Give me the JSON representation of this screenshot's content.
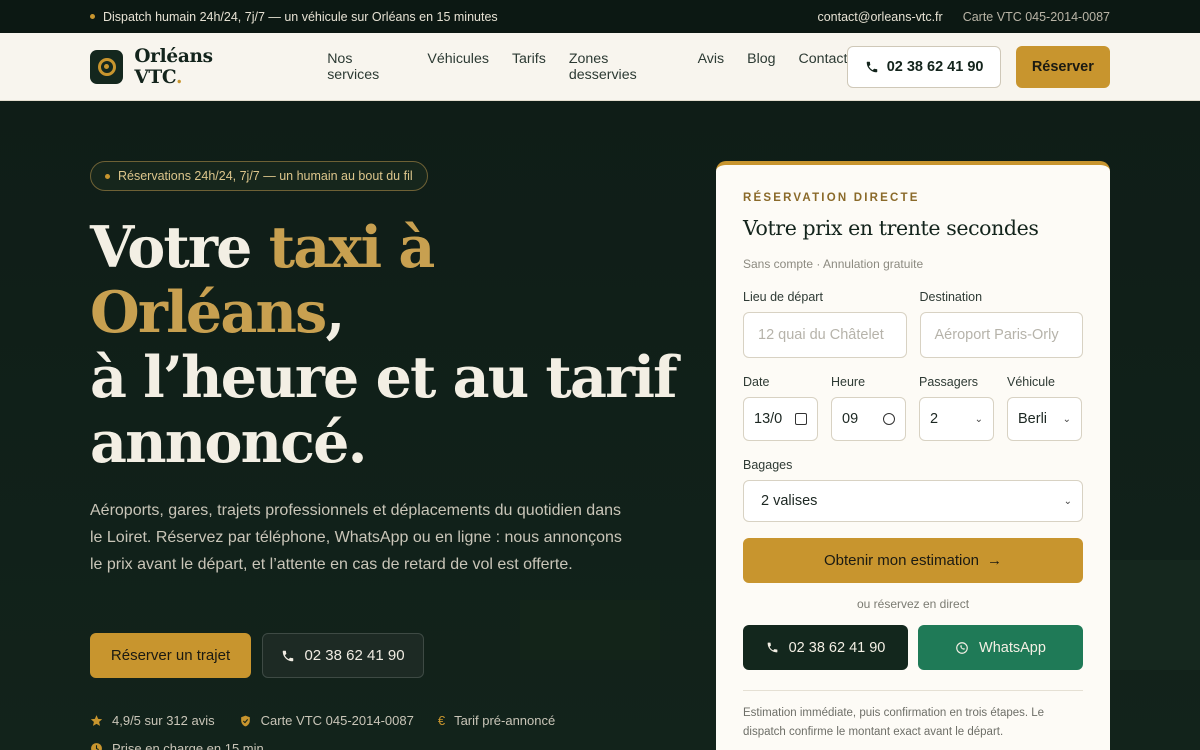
{
  "topbar": {
    "dispatch": "Dispatch humain 24h/24, 7j/7 — un véhicule sur Orléans en 15 minutes",
    "email": "contact@orleans-vtc.fr",
    "license": "Carte VTC 045-2014-0087"
  },
  "header": {
    "brand": "Orléans VTC",
    "brand_dot": ".",
    "nav": [
      "Nos services",
      "Véhicules",
      "Tarifs",
      "Zones desservies",
      "Avis",
      "Blog",
      "Contact"
    ],
    "phone": "02 38 62 41 90",
    "reserve": "Réserver"
  },
  "hero": {
    "badge": "Réservations 24h/24, 7j/7 — un humain au bout du fil",
    "h_line1_a": "Votre ",
    "h_line1_b": "taxi à",
    "h_line2_a": "Orléans",
    "h_line2_b": ",",
    "h_line3": "à l’heure et au tarif",
    "h_line4": "annoncé.",
    "lead": "Aéroports, gares, trajets professionnels et déplacements du quotidien dans le Loiret. Réservez par téléphone, WhatsApp ou en ligne : nous annonçons le prix avant le départ, et l’attente en cas de retard de vol est offerte.",
    "cta_primary": "Réserver un trajet",
    "cta_phone": "02 38 62 41 90",
    "trust": [
      {
        "icon": "star-icon",
        "text": "4,9/5 sur 312 avis"
      },
      {
        "icon": "shield-icon",
        "text": "Carte VTC 045-2014-0087"
      },
      {
        "icon": "euro-icon",
        "text": "Tarif pré-annoncé"
      }
    ],
    "trust2": "Prise en charge en 15 min"
  },
  "booking": {
    "eyebrow": "RÉSERVATION DIRECTE",
    "title": "Votre prix en trente secondes",
    "subtitle": "Sans compte · Annulation gratuite",
    "departure_label": "Lieu de départ",
    "departure_placeholder": "12 quai du Châtelet",
    "destination_label": "Destination",
    "destination_placeholder": "Aéroport Paris-Orly",
    "date_label": "Date",
    "date_value": "13/0",
    "time_label": "Heure",
    "time_value": "09",
    "passengers_label": "Passagers",
    "passengers_value": "2",
    "vehicle_label": "Véhicule",
    "vehicle_value": "Berli",
    "luggage_label": "Bagages",
    "luggage_value": "2 valises",
    "estimate_button": "Obtenir mon estimation",
    "or_text": "ou réservez en direct",
    "call_button": "02 38 62 41 90",
    "whatsapp_button": "WhatsApp",
    "footer_note": "Estimation immédiate, puis confirmation en trois étapes. Le dispatch confirme le montant exact avant le départ."
  },
  "colors": {
    "accent": "#c8952e",
    "dark": "#0f1d17",
    "whatsapp": "#1f7a57"
  }
}
